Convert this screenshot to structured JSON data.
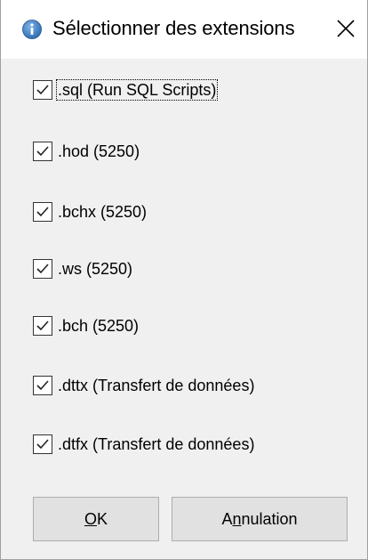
{
  "window": {
    "title": "Sélectionner des extensions",
    "icon": "info-icon",
    "close_icon": "close-icon"
  },
  "extensions": [
    {
      "label": ".sql (Run SQL Scripts)",
      "checked": true,
      "focused": true
    },
    {
      "label": ".hod (5250)",
      "checked": true
    },
    {
      "label": ".bchx (5250)",
      "checked": true
    },
    {
      "label": ".ws (5250)",
      "checked": true
    },
    {
      "label": ".bch (5250)",
      "checked": true
    },
    {
      "label": ".dttx (Transfert de données)",
      "checked": true
    },
    {
      "label": ".dtfx (Transfert de données)",
      "checked": true
    }
  ],
  "buttons": {
    "ok": {
      "mnemonic": "O",
      "rest": "K"
    },
    "cancel": {
      "before": "A",
      "mnemonic": "n",
      "rest": "nulation"
    }
  },
  "colors": {
    "icon_blue": "#2f6fb5",
    "button_bg": "#e1e1e1",
    "dialog_bg": "#f0f0f0"
  }
}
